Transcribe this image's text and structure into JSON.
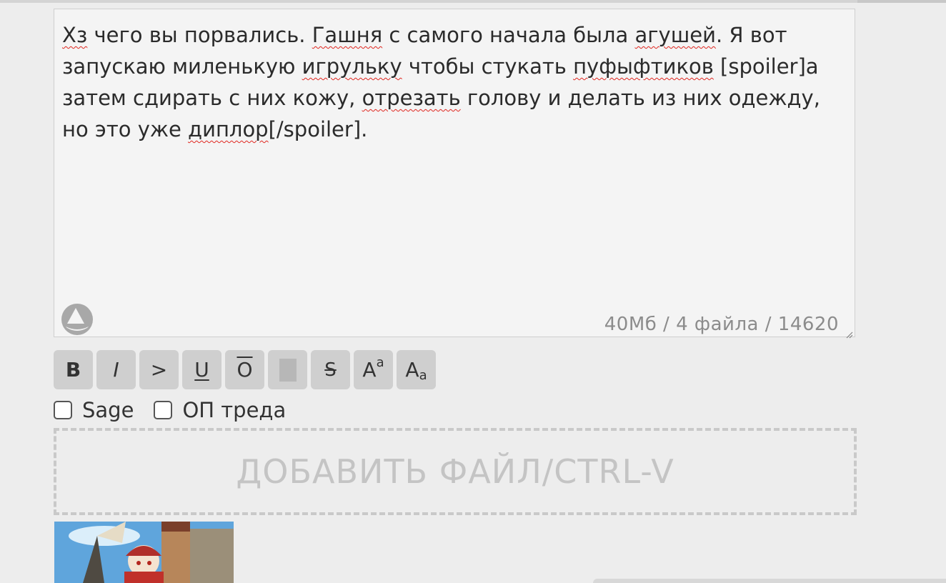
{
  "editor": {
    "segments": [
      {
        "t": "Хз",
        "sp": true
      },
      {
        "t": " чего вы порвались. ",
        "sp": false
      },
      {
        "t": "Гашня",
        "sp": true
      },
      {
        "t": " с самого начала была ",
        "sp": false
      },
      {
        "t": "агушей",
        "sp": true
      },
      {
        "t": ". Я вот запускаю миленькую ",
        "sp": false
      },
      {
        "t": "игрульку",
        "sp": true
      },
      {
        "t": " чтобы стукать ",
        "sp": false
      },
      {
        "t": "пуфыфтиков",
        "sp": true
      },
      {
        "t": " [spoiler]а затем сдирать с них кожу, ",
        "sp": false
      },
      {
        "t": "отрезать",
        "sp": true
      },
      {
        "t": " голову и делать из них одежду, но это уже ",
        "sp": false
      },
      {
        "t": "диплор",
        "sp": true
      },
      {
        "t": "[/spoiler].",
        "sp": false
      }
    ],
    "limits": "40Мб / 4 файла / 14620",
    "logo_icon": "sailboat-logo-icon"
  },
  "toolbar": {
    "bold": "B",
    "italic": "I",
    "quote": ">",
    "underline": "U",
    "overline": "O",
    "strike": "S",
    "sup_base": "A",
    "sup_small": "a",
    "sub_base": "A",
    "sub_small": "a"
  },
  "options": {
    "sage_label": "Sage",
    "op_label": "ОП треда"
  },
  "dropzone": {
    "label": "ДОБАВИТЬ ФАЙЛ/CTRL-V"
  },
  "colors": {
    "background": "#ededed",
    "editor_bg": "#f4f4f4",
    "button_bg": "#cfcfcf",
    "spellcheck": "#e0261f"
  }
}
